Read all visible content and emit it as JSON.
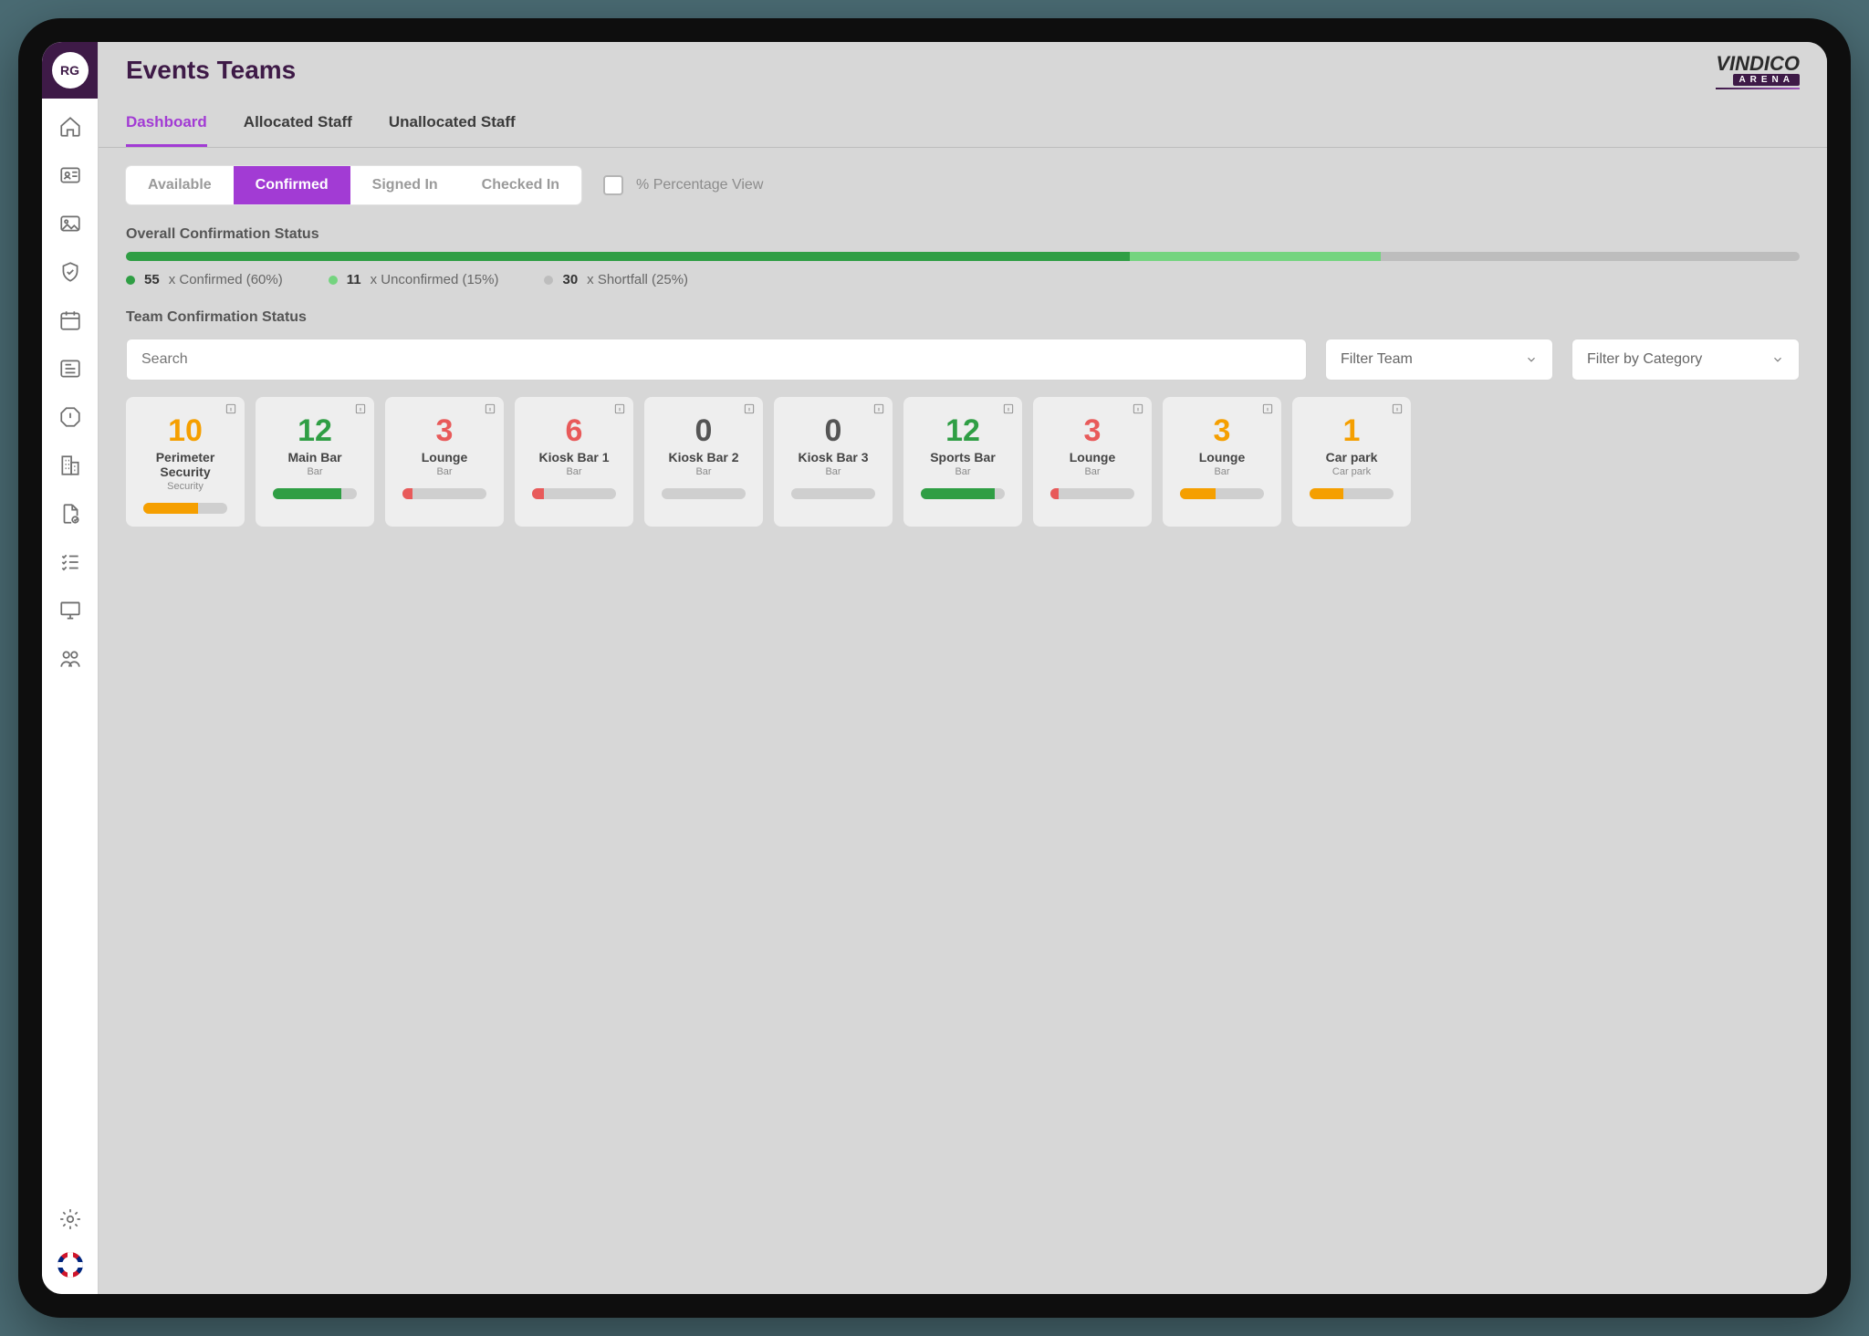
{
  "user_initials": "RG",
  "page_title": "Events Teams",
  "brand": {
    "name": "VINDICO",
    "subtitle": "ARENA"
  },
  "tabs": [
    {
      "label": "Dashboard",
      "active": true
    },
    {
      "label": "Allocated Staff",
      "active": false
    },
    {
      "label": "Unallocated Staff",
      "active": false
    }
  ],
  "status_pills": [
    {
      "label": "Available",
      "active": false
    },
    {
      "label": "Confirmed",
      "active": true
    },
    {
      "label": "Signed In",
      "active": false
    },
    {
      "label": "Checked In",
      "active": false
    }
  ],
  "percentage_view_label": "% Percentage View",
  "overall_heading": "Overall Confirmation Status",
  "overall": {
    "confirmed": {
      "count": 55,
      "label": "x Confirmed (60%)",
      "pct": 60,
      "color": "#2f9e44"
    },
    "unconfirmed": {
      "count": 11,
      "label": "x Unconfirmed (15%)",
      "pct": 15,
      "color": "#74d47f"
    },
    "shortfall": {
      "count": 30,
      "label": "x Shortfall (25%)",
      "pct": 25,
      "color": "#bdbdbd"
    }
  },
  "team_heading": "Team Confirmation Status",
  "search_placeholder": "Search",
  "filter_team_label": "Filter Team",
  "filter_category_label": "Filter by Category",
  "teams": [
    {
      "count": 10,
      "name": "Perimeter Security",
      "category": "Security",
      "color": "orange",
      "fill_pct": 65
    },
    {
      "count": 12,
      "name": "Main Bar",
      "category": "Bar",
      "color": "green",
      "fill_pct": 82
    },
    {
      "count": 3,
      "name": "Lounge",
      "category": "Bar",
      "color": "red",
      "fill_pct": 12
    },
    {
      "count": 6,
      "name": "Kiosk Bar 1",
      "category": "Bar",
      "color": "red",
      "fill_pct": 14
    },
    {
      "count": 0,
      "name": "Kiosk Bar 2",
      "category": "Bar",
      "color": "grey",
      "fill_pct": 0
    },
    {
      "count": 0,
      "name": "Kiosk Bar 3",
      "category": "Bar",
      "color": "grey",
      "fill_pct": 0
    },
    {
      "count": 12,
      "name": "Sports Bar",
      "category": "Bar",
      "color": "green",
      "fill_pct": 88
    },
    {
      "count": 3,
      "name": "Lounge",
      "category": "Bar",
      "color": "red",
      "fill_pct": 10
    },
    {
      "count": 3,
      "name": "Lounge",
      "category": "Bar",
      "color": "orange",
      "fill_pct": 42
    },
    {
      "count": 1,
      "name": "Car park",
      "category": "Car park",
      "color": "orange",
      "fill_pct": 40
    }
  ],
  "color_map": {
    "orange": "#f59f00",
    "green": "#2f9e44",
    "red": "#e85a5a",
    "grey": "#cfcfcf"
  }
}
